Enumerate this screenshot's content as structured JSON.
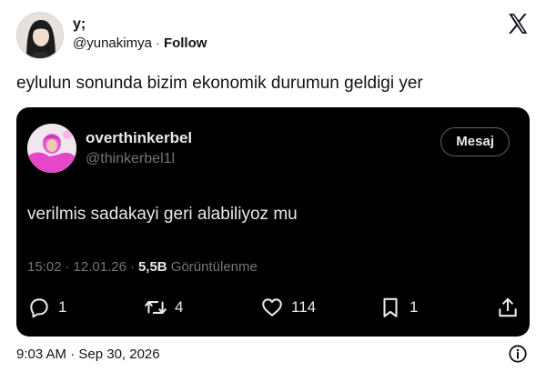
{
  "author": {
    "display_name": "y;",
    "handle": "@yunakimya",
    "separator": "·",
    "follow_label": "Follow"
  },
  "tweet": {
    "text": "eylulun sonunda bizim ekonomik durumun geldigi yer"
  },
  "quoted": {
    "display_name": "overthinkerbel",
    "handle": "@thinkerbel1l",
    "message_button": "Mesaj",
    "text": "verilmis sadakayi geri alabiliyoz mu",
    "time": "15:02",
    "sep": "·",
    "date": "12.01.26",
    "views_count": "5,5B",
    "views_label": "Görüntülenme",
    "replies": "1",
    "reposts": "4",
    "likes": "114",
    "bookmarks": "1"
  },
  "footer": {
    "timestamp": "9:03 AM · Sep 30, 2026"
  },
  "icons": {
    "logo": "x-logo-icon",
    "reply": "reply-icon",
    "repost": "repost-icon",
    "like": "heart-icon",
    "bookmark": "bookmark-icon",
    "share": "share-icon",
    "info": "info-icon"
  },
  "colors": {
    "card_bg": "#000000",
    "card_text": "#e7e9ea",
    "card_muted": "#71767b",
    "page_text": "#0f1419"
  }
}
